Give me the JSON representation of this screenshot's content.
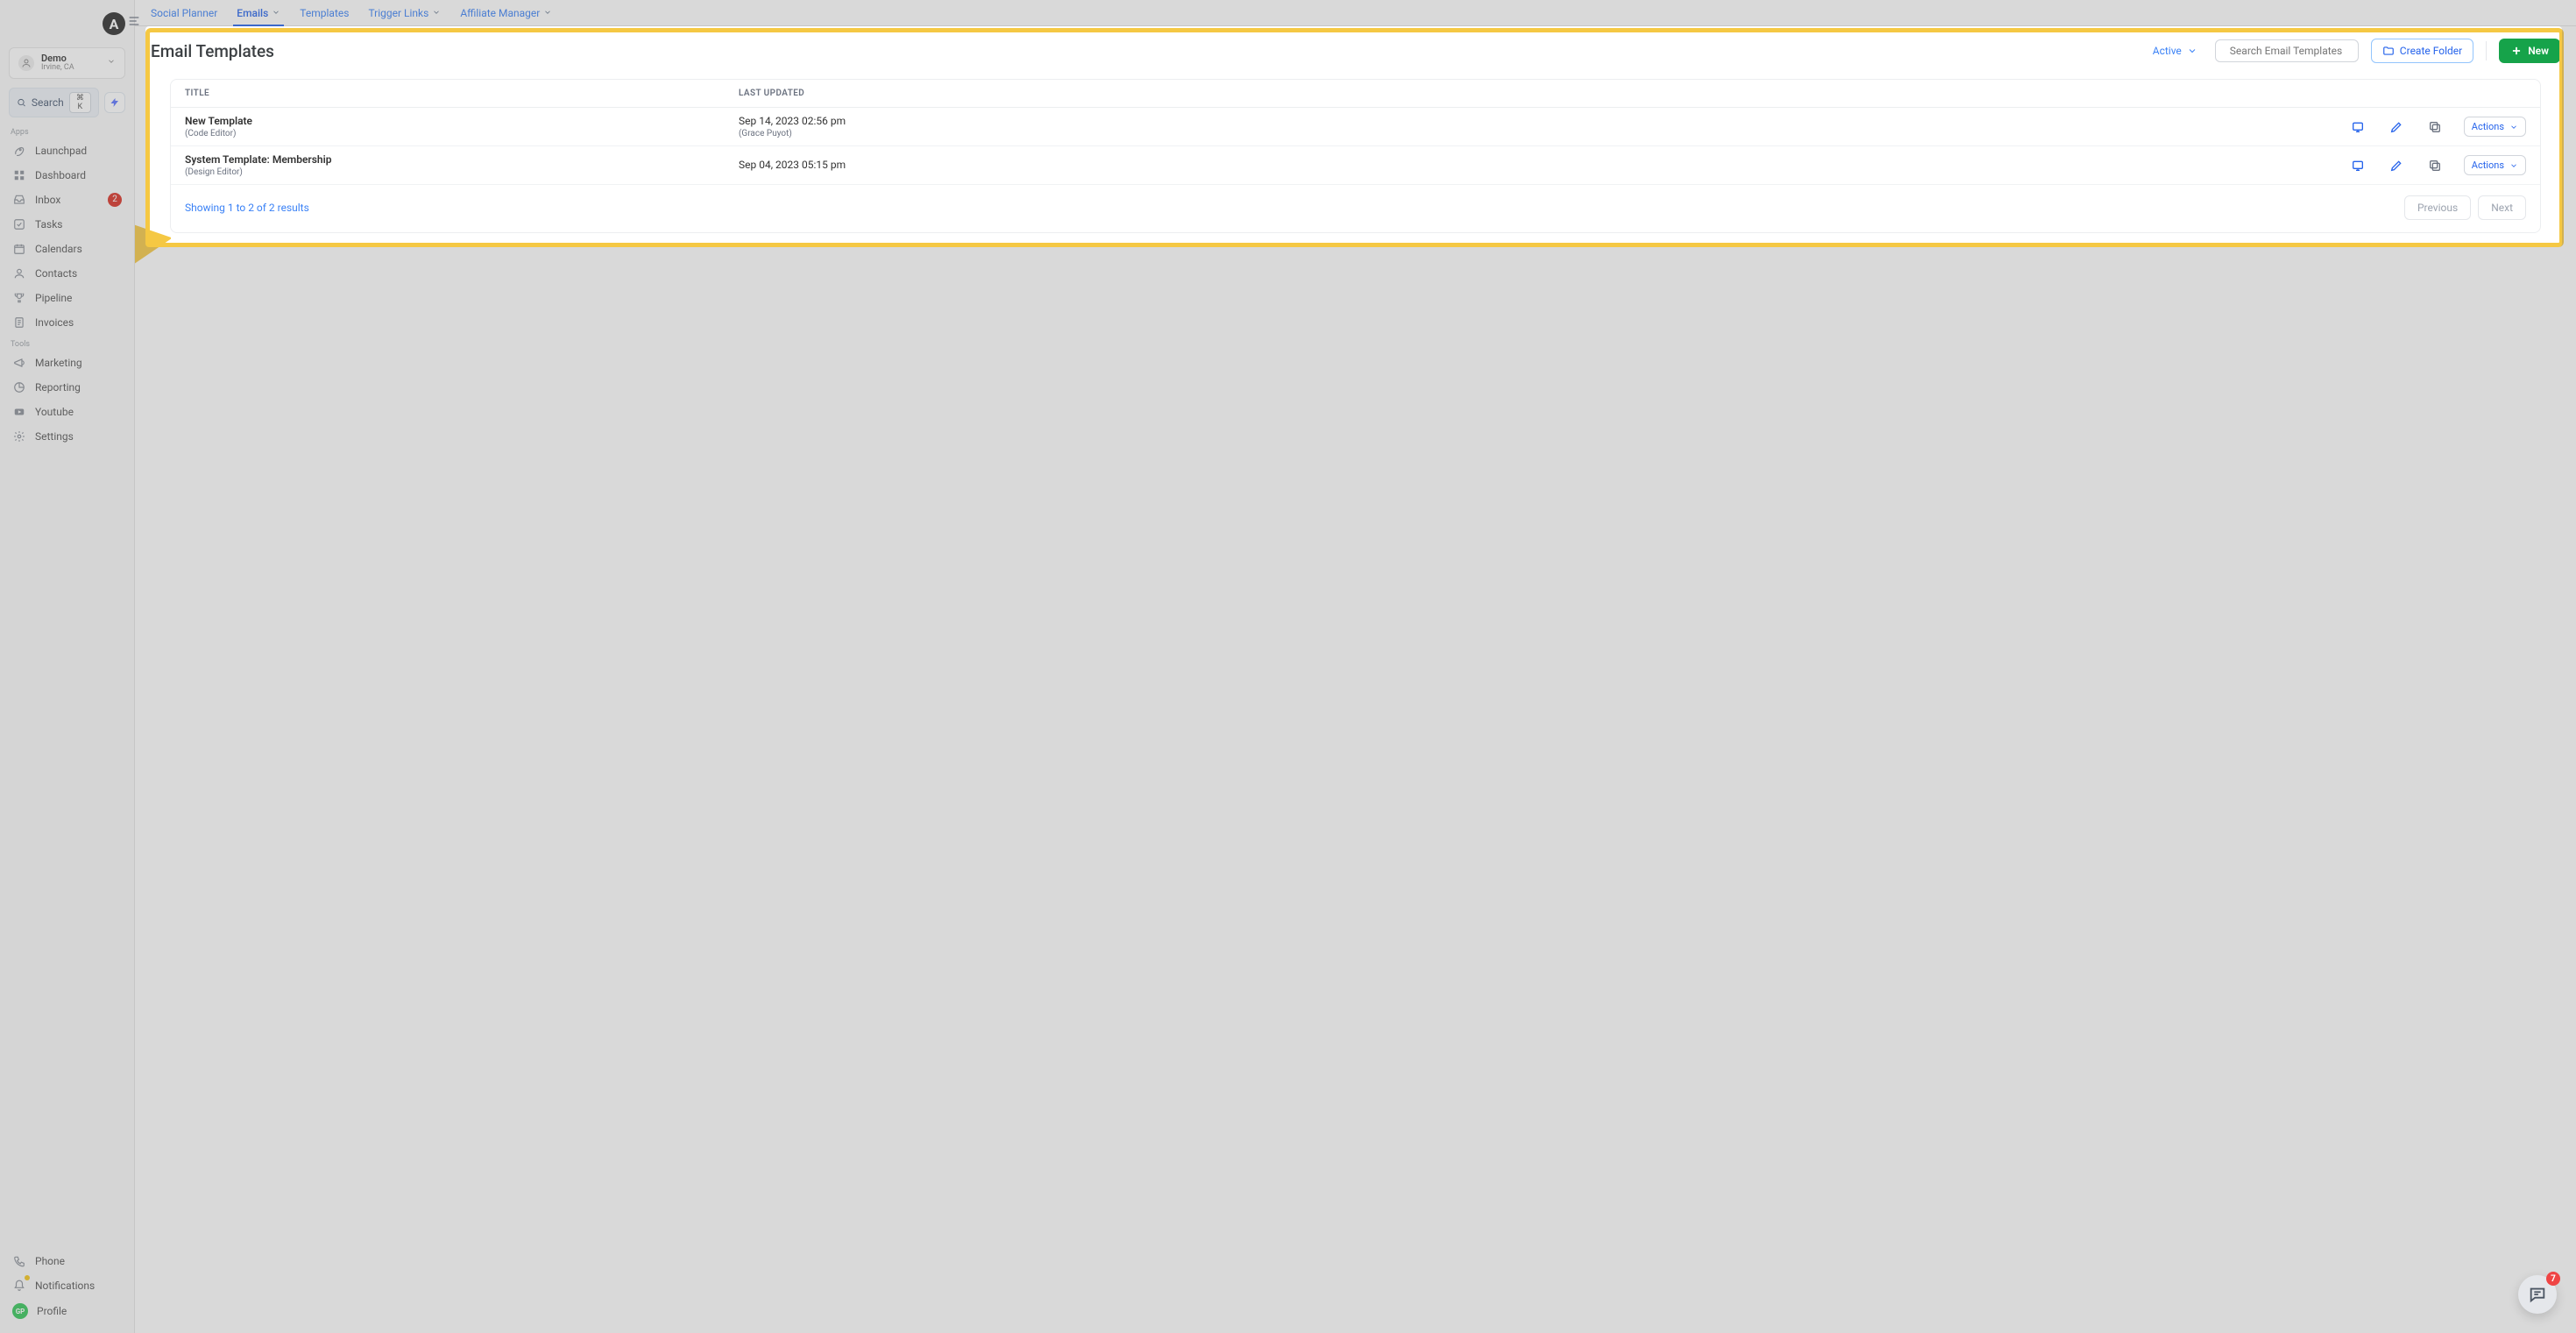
{
  "org": {
    "name": "Demo",
    "loc": "Irvine, CA"
  },
  "sidebar": {
    "search_label": "Search",
    "search_shortcut": "⌘ K",
    "section_apps": "Apps",
    "section_tools": "Tools",
    "apps": [
      {
        "label": "Launchpad",
        "icon": "rocket"
      },
      {
        "label": "Dashboard",
        "icon": "grid"
      },
      {
        "label": "Inbox",
        "icon": "inbox",
        "badge": "2"
      },
      {
        "label": "Tasks",
        "icon": "check"
      },
      {
        "label": "Calendars",
        "icon": "calendar"
      },
      {
        "label": "Contacts",
        "icon": "user"
      },
      {
        "label": "Pipeline",
        "icon": "trophy"
      },
      {
        "label": "Invoices",
        "icon": "invoice"
      }
    ],
    "tools": [
      {
        "label": "Marketing",
        "icon": "megaphone"
      },
      {
        "label": "Reporting",
        "icon": "chart"
      },
      {
        "label": "Youtube",
        "icon": "youtube"
      },
      {
        "label": "Settings",
        "icon": "gear"
      }
    ],
    "bottom": {
      "phone": "Phone",
      "notifications": "Notifications",
      "profile": "Profile",
      "profile_initials": "GP"
    }
  },
  "topnav": {
    "items": [
      {
        "label": "Social Planner"
      },
      {
        "label": "Emails",
        "active": true,
        "dropdown": true
      },
      {
        "label": "Templates"
      },
      {
        "label": "Trigger Links",
        "dropdown": true
      },
      {
        "label": "Affiliate Manager",
        "dropdown": true
      }
    ]
  },
  "page": {
    "title": "Email Templates",
    "filter_active": "Active",
    "search_placeholder": "Search Email Templates",
    "create_folder": "Create Folder",
    "new_btn": "New"
  },
  "table": {
    "col_title": "TITLE",
    "col_updated": "LAST UPDATED",
    "rows": [
      {
        "title": "New Template",
        "subtitle": "(Code Editor)",
        "updated": "Sep 14, 2023 02:56 pm",
        "updated_by": "(Grace Puyot)",
        "actions_label": "Actions"
      },
      {
        "title": "System Template: Membership",
        "subtitle": "(Design Editor)",
        "updated": "Sep 04, 2023 05:15 pm",
        "updated_by": "",
        "actions_label": "Actions"
      }
    ],
    "results_text": "Showing 1 to 2 of 2 results",
    "prev": "Previous",
    "next": "Next"
  },
  "chat_badge": "7",
  "brand_initial": "A"
}
